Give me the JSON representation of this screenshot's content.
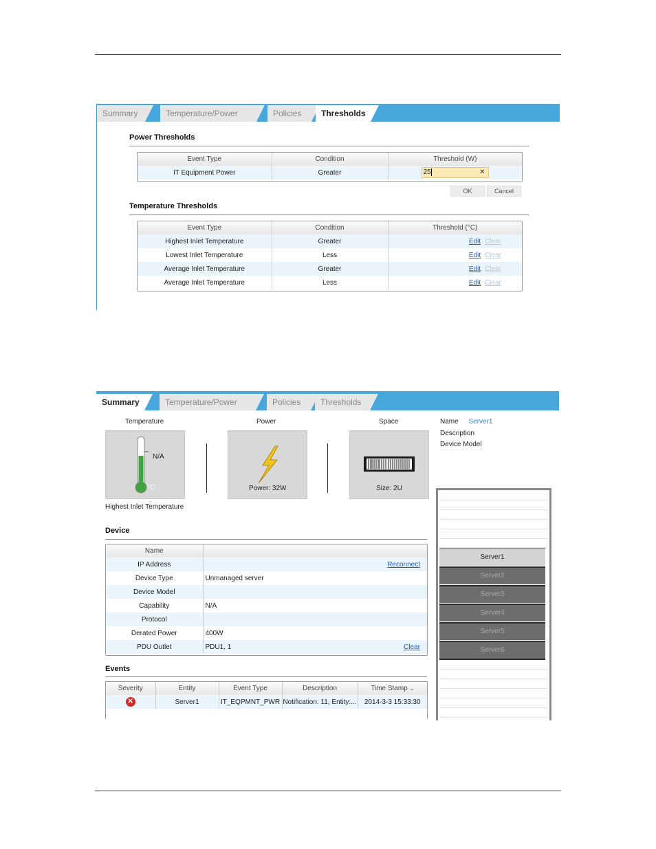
{
  "panel1": {
    "tabs": [
      "Summary",
      "Temperature/Power",
      "Policies",
      "Thresholds"
    ],
    "active_tab": "Thresholds",
    "power_section_title": "Power Thresholds",
    "power_headers": [
      "Event Type",
      "Condition",
      "Threshold (W)"
    ],
    "power_row": {
      "event": "IT Equipment Power",
      "condition": "Greater",
      "value": "25"
    },
    "ok_label": "OK",
    "cancel_label": "Cancel",
    "temp_section_title": "Temperature Thresholds",
    "temp_headers": [
      "Event Type",
      "Condition",
      "Threshold (°C)"
    ],
    "temp_rows": [
      {
        "event": "Highest Inlet Temperature",
        "condition": "Greater"
      },
      {
        "event": "Lowest Inlet Temperature",
        "condition": "Less"
      },
      {
        "event": "Average Inlet Temperature",
        "condition": "Greater"
      },
      {
        "event": "Average Inlet Temperature",
        "condition": "Less"
      }
    ],
    "edit_label": "Edit",
    "clear_label": "Clear"
  },
  "panel2": {
    "tabs": [
      "Summary",
      "Temperature/Power",
      "Policies",
      "Thresholds"
    ],
    "active_tab": "Summary",
    "temperature_label": "Temperature",
    "power_label": "Power",
    "space_label": "Space",
    "thermo_value": "N/A",
    "thermo_unit": "°C",
    "power_value": "Power: 32W",
    "size_value": "Size: 2U",
    "highest_inlet_label": "Highest Inlet Temperature",
    "info": {
      "name_label": "Name",
      "name_value": "Server1",
      "description_label": "Description",
      "model_label": "Device Model"
    },
    "device_section_title": "Device",
    "device_rows": [
      {
        "label": "Name",
        "value": ""
      },
      {
        "label": "IP Address",
        "value": ""
      },
      {
        "label": "Device Type",
        "value": "Unmanaged server"
      },
      {
        "label": "Device Model",
        "value": ""
      },
      {
        "label": "Capability",
        "value": "N/A"
      },
      {
        "label": "Protocol",
        "value": ""
      },
      {
        "label": "Derated Power",
        "value": "400W"
      },
      {
        "label": "PDU Outlet",
        "value": "PDU1, 1"
      }
    ],
    "reconnect_label": "Reconnect",
    "clear_label": "Clear",
    "events_section_title": "Events",
    "event_headers": [
      "Severity",
      "Entity",
      "Event Type",
      "Description",
      "Time Stamp"
    ],
    "event_row": {
      "entity": "Server1",
      "type": "IT_EQPMNT_PWR",
      "description": "Notification: 11, Entity:...",
      "time": "2014-3-3 15:33:30"
    },
    "rack_slots": [
      "Server1",
      "Server2",
      "Server3",
      "Server4",
      "Server5",
      "Server6"
    ],
    "selected_slot": "Server1"
  }
}
